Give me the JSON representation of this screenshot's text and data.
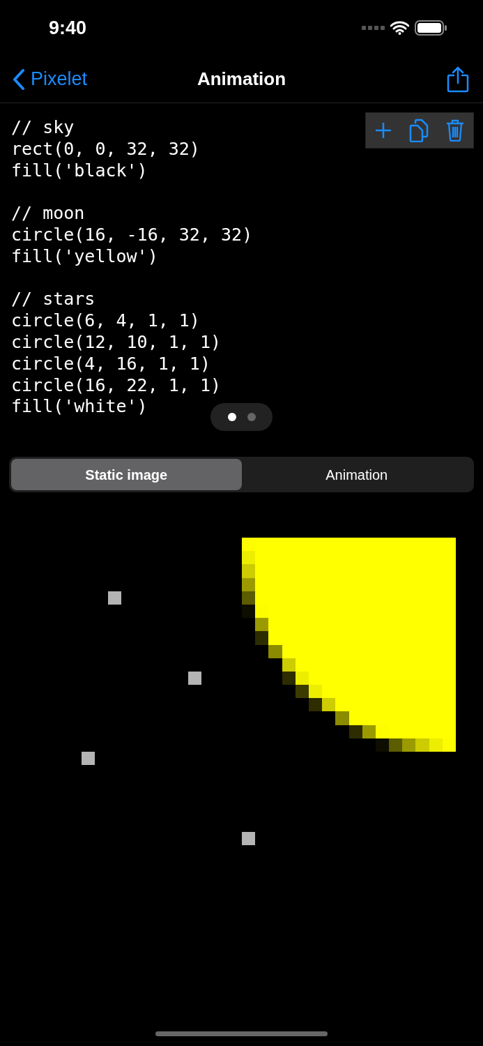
{
  "status_bar": {
    "time": "9:40"
  },
  "nav_bar": {
    "back_label": "Pixelet",
    "title": "Animation"
  },
  "code_blocks": [
    {
      "lines": [
        "// sky",
        "rect(0, 0, 32, 32)",
        "fill('black')"
      ]
    },
    {
      "lines": [
        "// moon",
        "circle(16, -16, 32, 32)",
        "fill('yellow')"
      ]
    },
    {
      "lines": [
        "// stars",
        "circle(6, 4, 1, 1)",
        "circle(12, 10, 1, 1)",
        "circle(4, 16, 1, 1)",
        "circle(16, 22, 1, 1)",
        "fill('white')"
      ]
    }
  ],
  "page_dots": [
    {
      "selected": true
    },
    {
      "selected": false
    }
  ],
  "segments": [
    {
      "label": "Static image",
      "selected": true
    },
    {
      "label": "Animation",
      "selected": false
    }
  ]
}
